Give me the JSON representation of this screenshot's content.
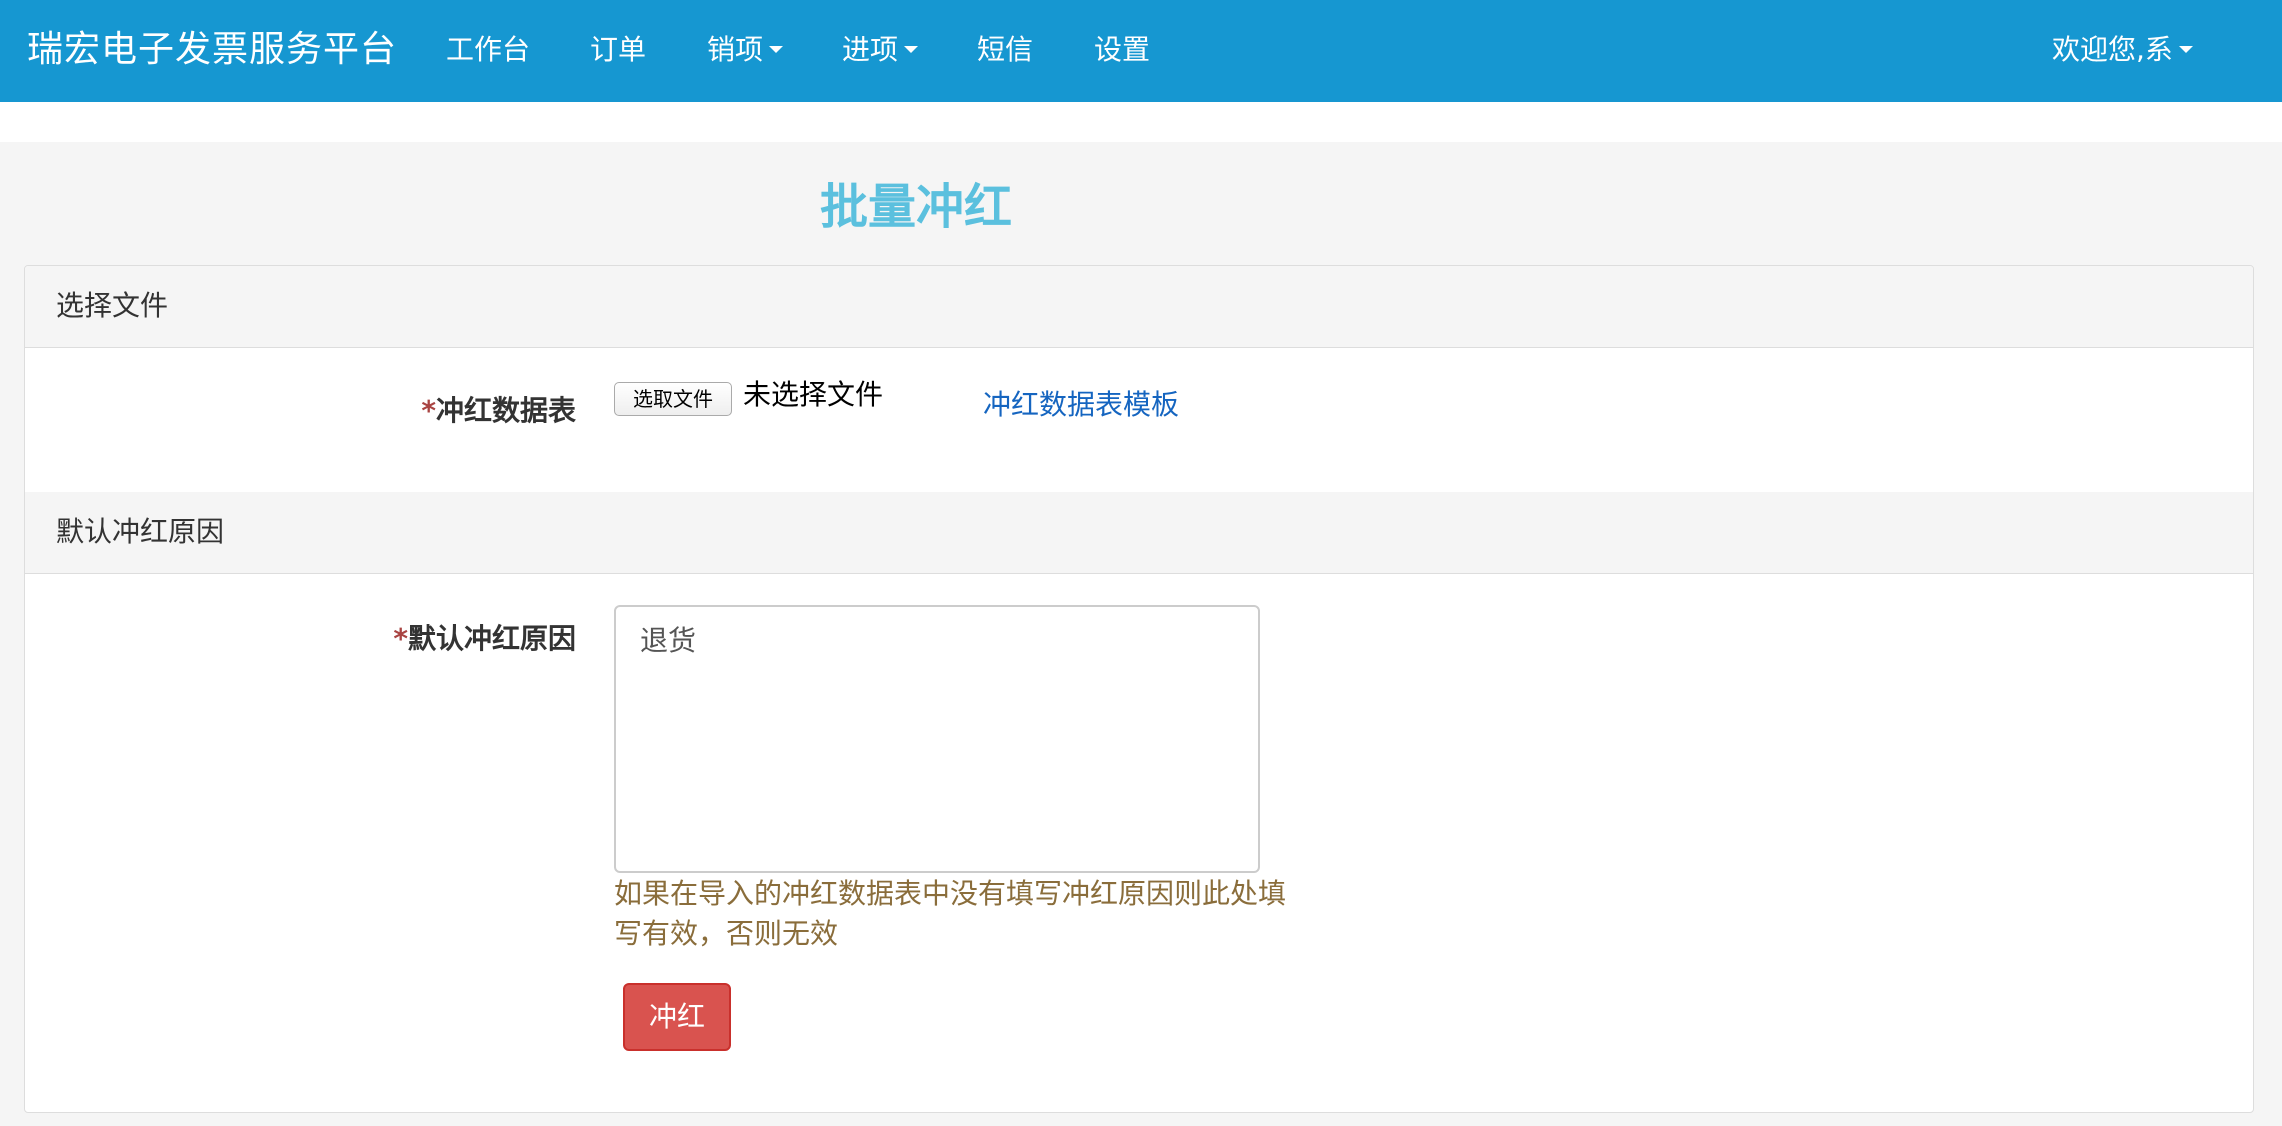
{
  "navbar": {
    "brand": "瑞宏电子发票服务平台",
    "items": [
      {
        "label": "工作台",
        "dropdown": false
      },
      {
        "label": "订单",
        "dropdown": false
      },
      {
        "label": "销项",
        "dropdown": true
      },
      {
        "label": "进项",
        "dropdown": true
      },
      {
        "label": "短信",
        "dropdown": false
      },
      {
        "label": "设置",
        "dropdown": false
      }
    ],
    "user_menu": "欢迎您,系"
  },
  "page": {
    "title": "批量冲红"
  },
  "sections": {
    "file": {
      "heading": "选择文件",
      "field_label": "冲红数据表",
      "required_mark": "*",
      "file_button": "选取文件",
      "file_status": "未选择文件",
      "template_link": "冲红数据表模板"
    },
    "reason": {
      "heading": "默认冲红原因",
      "field_label": "默认冲红原因",
      "required_mark": "*",
      "value": "退货",
      "help": "如果在导入的冲红数据表中没有填写冲红原因则此处填写有效，否则无效"
    }
  },
  "actions": {
    "submit_label": "冲红"
  },
  "colors": {
    "navbar": "#1697d1",
    "title": "#5bc0de",
    "link": "#1565c0",
    "help": "#8a6d3b",
    "danger": "#d9534f",
    "required": "#a94442"
  }
}
